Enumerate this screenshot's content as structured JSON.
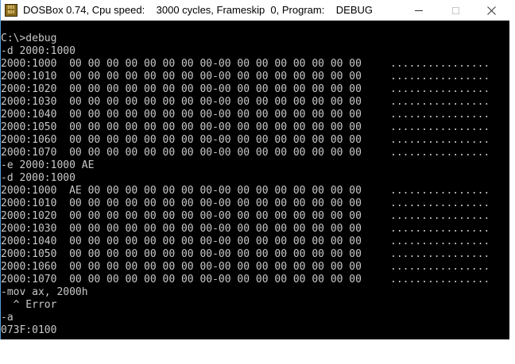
{
  "window": {
    "title": "DOSBox 0.74, Cpu speed:    3000 cycles, Frameskip  0, Program:    DEBUG",
    "icon": "dosbox-icon",
    "icon_text": [
      "DOS",
      "BOX"
    ],
    "buttons": [
      "minimize-icon",
      "maximize-icon",
      "close-icon"
    ]
  },
  "colors": {
    "background": "#000000",
    "text": "#c8c8c8",
    "titlebar": "#ffffff",
    "border": "#5a9bd5"
  },
  "terminal": {
    "lines": [
      {
        "text": "C:\\>debug"
      },
      {
        "text": "-d 2000:1000"
      },
      {
        "text": "2000:1000  00 00 00 00 00 00 00 00-00 00 00 00 00 00 00 00",
        "ascii": "................"
      },
      {
        "text": "2000:1010  00 00 00 00 00 00 00 00-00 00 00 00 00 00 00 00",
        "ascii": "................"
      },
      {
        "text": "2000:1020  00 00 00 00 00 00 00 00-00 00 00 00 00 00 00 00",
        "ascii": "................"
      },
      {
        "text": "2000:1030  00 00 00 00 00 00 00 00-00 00 00 00 00 00 00 00",
        "ascii": "................"
      },
      {
        "text": "2000:1040  00 00 00 00 00 00 00 00-00 00 00 00 00 00 00 00",
        "ascii": "................"
      },
      {
        "text": "2000:1050  00 00 00 00 00 00 00 00-00 00 00 00 00 00 00 00",
        "ascii": "................"
      },
      {
        "text": "2000:1060  00 00 00 00 00 00 00 00-00 00 00 00 00 00 00 00",
        "ascii": "................"
      },
      {
        "text": "2000:1070  00 00 00 00 00 00 00 00-00 00 00 00 00 00 00 00",
        "ascii": "................"
      },
      {
        "text": "-e 2000:1000 AE"
      },
      {
        "text": "-d 2000:1000"
      },
      {
        "text": "2000:1000  AE 00 00 00 00 00 00 00-00 00 00 00 00 00 00 00",
        "ascii": "................"
      },
      {
        "text": "2000:1010  00 00 00 00 00 00 00 00-00 00 00 00 00 00 00 00",
        "ascii": "................"
      },
      {
        "text": "2000:1020  00 00 00 00 00 00 00 00-00 00 00 00 00 00 00 00",
        "ascii": "................"
      },
      {
        "text": "2000:1030  00 00 00 00 00 00 00 00-00 00 00 00 00 00 00 00",
        "ascii": "................"
      },
      {
        "text": "2000:1040  00 00 00 00 00 00 00 00-00 00 00 00 00 00 00 00",
        "ascii": "................"
      },
      {
        "text": "2000:1050  00 00 00 00 00 00 00 00-00 00 00 00 00 00 00 00",
        "ascii": "................"
      },
      {
        "text": "2000:1060  00 00 00 00 00 00 00 00-00 00 00 00 00 00 00 00",
        "ascii": "................"
      },
      {
        "text": "2000:1070  00 00 00 00 00 00 00 00-00 00 00 00 00 00 00 00",
        "ascii": "................"
      },
      {
        "text": "-mov ax, 2000h"
      },
      {
        "text": "  ^ Error"
      },
      {
        "text": "-a"
      },
      {
        "text": "073F:0100"
      }
    ]
  }
}
